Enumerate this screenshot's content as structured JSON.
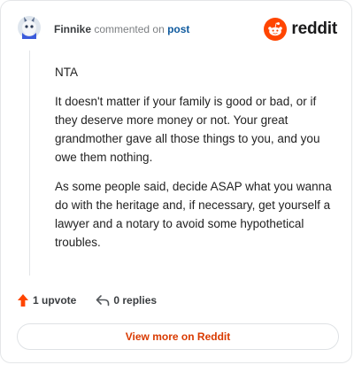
{
  "header": {
    "author": "Finnike",
    "action_text": "commented on",
    "post_link": "post"
  },
  "brand": {
    "wordmark": "reddit",
    "icon": "reddit-logo-icon",
    "color": "#ff4500"
  },
  "comment": {
    "paragraphs": [
      "NTA",
      "It doesn't matter if your family is good or bad, or if they deserve more money or not. Your great grandmother gave all those things to you, and you owe them nothing.",
      "As some people said, decide ASAP what you wanna do with the heritage and, if necessary, get yourself a lawyer and a notary to avoid some hypothetical troubles."
    ]
  },
  "footer": {
    "upvote_label": "1 upvote",
    "upvote_icon": "upvote-arrow-icon",
    "upvote_color": "#ff4500",
    "reply_label": "0 replies",
    "reply_icon": "reply-arrow-icon"
  },
  "cta": {
    "label": "View more on Reddit",
    "color": "#d93a00"
  }
}
